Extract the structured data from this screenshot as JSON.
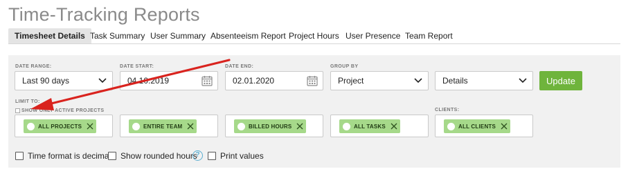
{
  "title": "Time-Tracking Reports",
  "tabs": [
    {
      "label": "Timesheet Details",
      "active": true
    },
    {
      "label": "Task Summary"
    },
    {
      "label": "User Summary"
    },
    {
      "label": "Absenteeism Report"
    },
    {
      "label": "Project Hours"
    },
    {
      "label": "User Presence"
    },
    {
      "label": "Team Report"
    }
  ],
  "filters": {
    "date_range": {
      "label": "DATE RANGE:",
      "value": "Last 90 days"
    },
    "date_start": {
      "label": "DATE START:",
      "value": "04.10.2019"
    },
    "date_end": {
      "label": "DATE END:",
      "value": "02.01.2020"
    },
    "group_by": {
      "label": "GROUP BY",
      "value": "Project"
    },
    "detail": {
      "value": "Details"
    },
    "update_label": "Update"
  },
  "limit": {
    "label": "LIMIT TO:",
    "active_projects_label": "SHOW ONLY ACTIVE PROJECTS",
    "clients_label": "CLIENTS:",
    "chips": [
      "ALL PROJECTS",
      "ENTIRE TEAM",
      "BILLED HOURS",
      "ALL TASKS",
      "ALL CLIENTS"
    ]
  },
  "options": {
    "decimal": "Time format is decimal",
    "rounded": "Show rounded hours",
    "help": "?",
    "print": "Print values"
  },
  "colors": {
    "accent_green": "#6fb43c",
    "chip_green": "#a6d98a",
    "annotation_red": "#d9231e",
    "help_blue": "#5aaed1"
  }
}
